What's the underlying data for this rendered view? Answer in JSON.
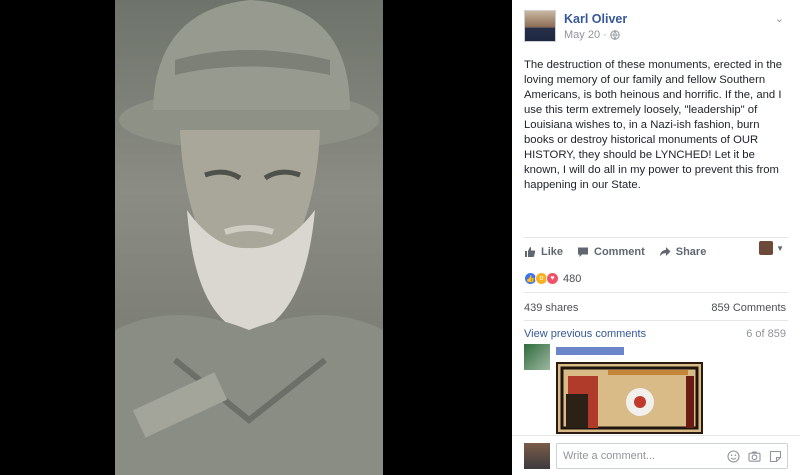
{
  "post": {
    "author": "Karl Oliver",
    "date": "May 20",
    "separator": "·",
    "privacy_icon": "globe-icon",
    "body": "The destruction of these monuments, erected in the loving memory of our family and fellow Southern Americans, is both heinous and horrific. If the, and I use this term extremely loosely, \"leadership\" of Louisiana wishes to, in a Nazi-ish fashion, burn books or destroy historical monuments of OUR HISTORY, they should be LYNCHED! Let it be known, I will do all in my power to prevent this from happening in our State."
  },
  "actions": {
    "like": "Like",
    "comment": "Comment",
    "share": "Share"
  },
  "reactions": {
    "count": "480",
    "types": [
      "like-icon",
      "wow-icon",
      "love-icon"
    ]
  },
  "stats": {
    "shares": "439 shares",
    "comments": "859 Comments"
  },
  "comments": {
    "view_previous": "View previous comments",
    "pager": "6 of 859"
  },
  "write_comment": {
    "placeholder": "Write a comment..."
  },
  "colors": {
    "link": "#365899",
    "meta": "#90949c",
    "like_blue": "#3b74f4",
    "wow_yellow": "#f7b125",
    "love_red": "#f25268"
  }
}
